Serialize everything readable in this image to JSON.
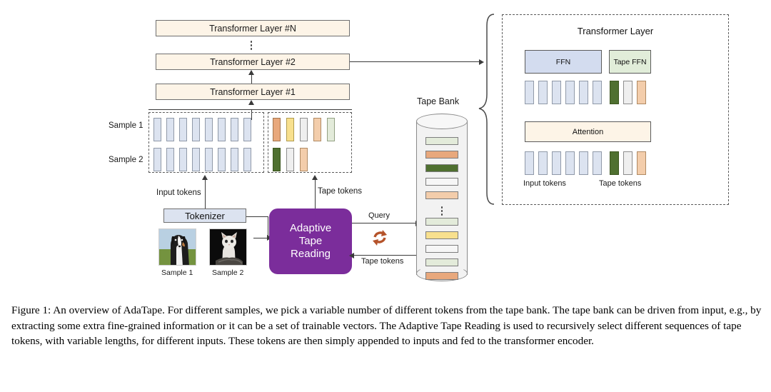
{
  "figure": {
    "stack": {
      "layer_n": "Transformer Layer #N",
      "layer_2": "Transformer Layer #2",
      "layer_1": "Transformer Layer #1"
    },
    "samples": {
      "sample_1_label": "Sample 1",
      "sample_2_label": "Sample 2",
      "input_tokens_label": "Input tokens",
      "tape_tokens_label": "Tape tokens",
      "sample_1_input_count": 8,
      "sample_2_input_count": 8,
      "sample_1_tape_colors": [
        "orange",
        "yellow",
        "gray",
        "peach",
        "light-green"
      ],
      "sample_2_tape_colors": [
        "dark-green",
        "gray",
        "peach"
      ]
    },
    "tokenizer": {
      "label": "Tokenizer"
    },
    "adaptive_tape_reading": {
      "line_1": "Adaptive",
      "line_2": "Tape",
      "line_3": "Reading"
    },
    "image_samples": [
      {
        "caption": "Sample 1",
        "subject": "dog-photo"
      },
      {
        "caption": "Sample 2",
        "subject": "cat-photo"
      }
    ],
    "tape_bank": {
      "title": "Tape Bank",
      "query_label": "Query",
      "return_label": "Tape tokens",
      "bars_top": [
        "light-green",
        "orange",
        "dark-green",
        "gray",
        "peach"
      ],
      "bars_bottom": [
        "light-green",
        "yellow",
        "gray",
        "light-green",
        "orange"
      ]
    },
    "detail_panel": {
      "title": "Transformer Layer",
      "ffn_label": "FFN",
      "tape_ffn_label": "Tape FFN",
      "attention_label": "Attention",
      "input_tokens_label": "Input tokens",
      "tape_tokens_label": "Tape tokens",
      "top_input_count": 6,
      "top_tape_colors": [
        "dark-green",
        "gray",
        "peach"
      ],
      "bottom_input_count": 6,
      "bottom_tape_colors": [
        "dark-green",
        "gray",
        "peach"
      ]
    },
    "colors": {
      "cream": "#FDF4E7",
      "input_token_blue": "#DCE3F0",
      "purple": "#7B2D9B",
      "orange": "#E8A87C",
      "yellow": "#F8E08E",
      "dark_green": "#4F7030",
      "light_green": "#E3EBDA",
      "peach": "#F3CDAB",
      "gray": "#EFEFEF",
      "refresh_arrow_brown": "#B5532A"
    }
  },
  "caption": {
    "text": "Figure 1: An overview of AdaTape. For different samples, we pick a variable number of different tokens from the tape bank. The tape bank can be driven from input, e.g., by extracting some extra fine-grained information or it can be a set of trainable vectors. The Adaptive Tape Reading is used to recursively select different sequences of tape tokens, with variable lengths, for different inputs. These tokens are then simply appended to inputs and fed to the transformer encoder."
  }
}
